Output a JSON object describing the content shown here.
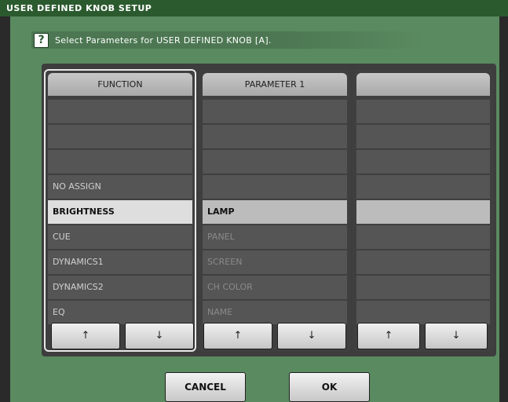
{
  "window": {
    "title": "USER DEFINED KNOB SETUP"
  },
  "prompt": {
    "icon": "question-icon",
    "text": "Select Parameters for USER DEFINED KNOB [A]."
  },
  "columns": [
    {
      "header": "FUNCTION",
      "rows": [
        "",
        "",
        "",
        "NO ASSIGN",
        "BRIGHTNESS",
        "CUE",
        "DYNAMICS1",
        "DYNAMICS2",
        "EQ"
      ],
      "selected_index": 4
    },
    {
      "header": "PARAMETER 1",
      "rows": [
        "",
        "",
        "",
        "",
        "LAMP",
        "PANEL",
        "SCREEN",
        "CH COLOR",
        "NAME"
      ],
      "selected_index": 4
    },
    {
      "header": "",
      "rows": [
        "",
        "",
        "",
        "",
        "",
        "",
        "",
        "",
        ""
      ],
      "selected_index": 4
    }
  ],
  "arrows": {
    "up": "↑",
    "down": "↓"
  },
  "buttons": {
    "cancel": "CANCEL",
    "ok": "OK"
  },
  "colors": {
    "background": "#5a8a60",
    "titlebar": "#2c5a2f",
    "row": "#555555",
    "selected_row": "#dedede"
  }
}
